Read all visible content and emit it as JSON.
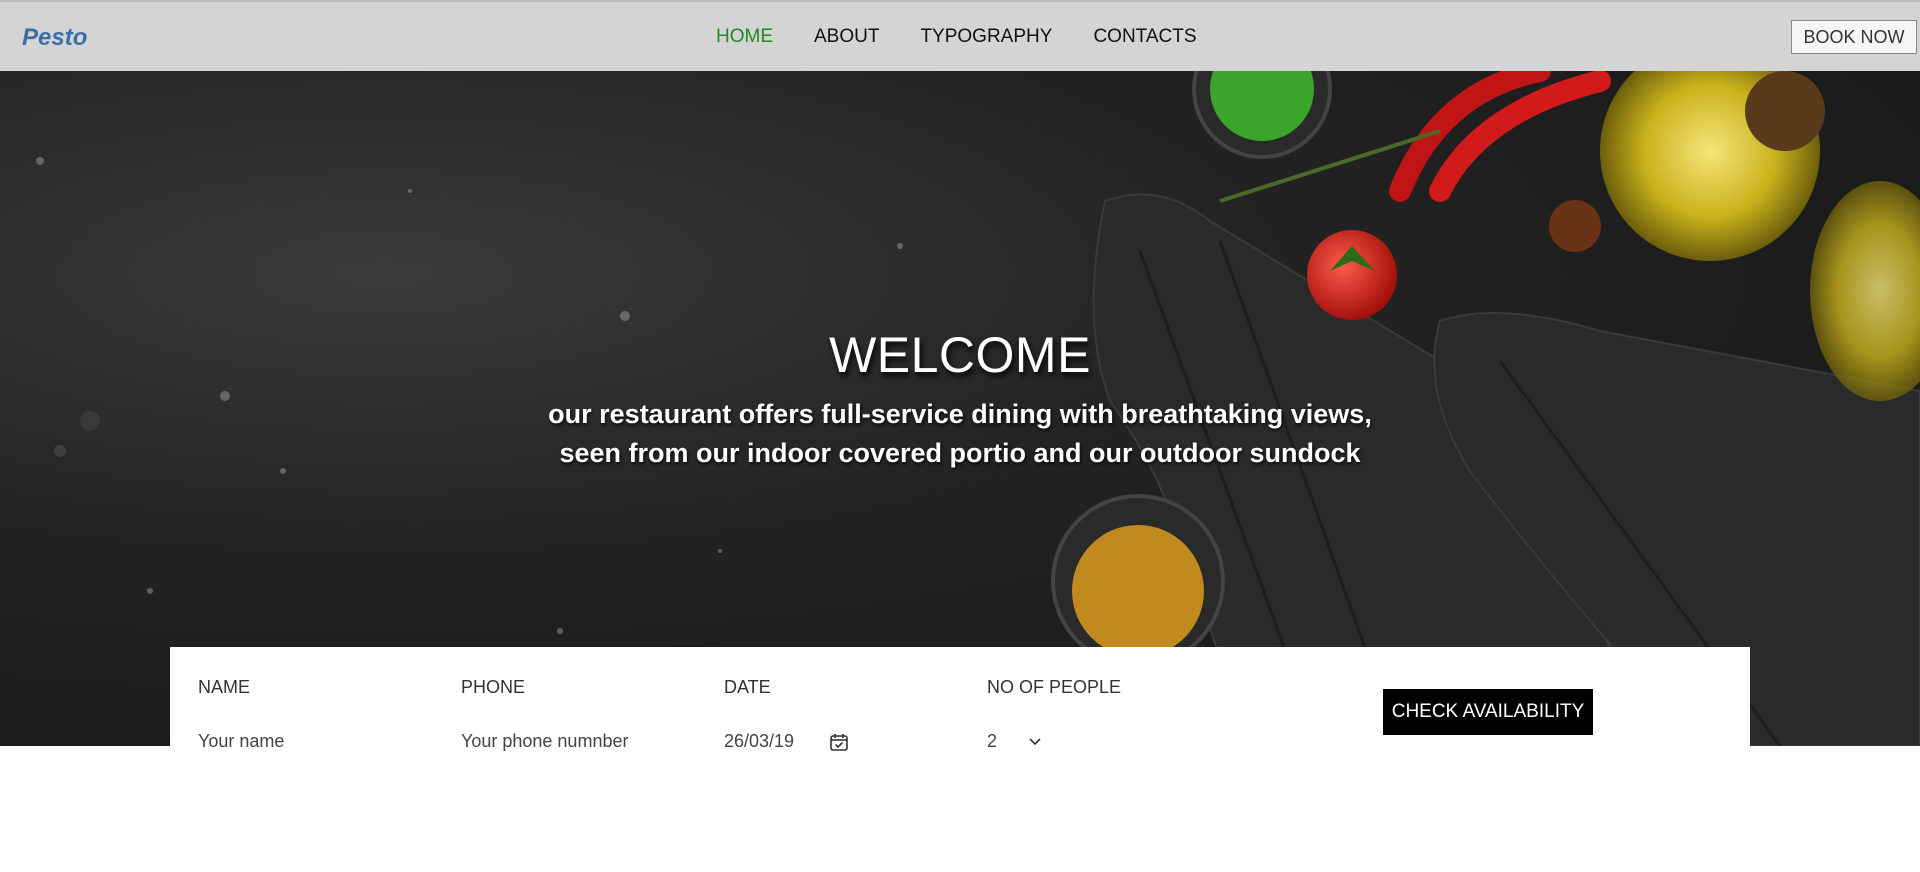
{
  "brand": {
    "name": "Pesto",
    "color": "#3b6ea5"
  },
  "nav": {
    "items": [
      {
        "label": "HOME",
        "active": true
      },
      {
        "label": "ABOUT",
        "active": false
      },
      {
        "label": "TYPOGRAPHY",
        "active": false
      },
      {
        "label": "CONTACTS",
        "active": false
      }
    ],
    "active_color": "#1f8a1f",
    "book_now_label": "BOOK NOW"
  },
  "hero": {
    "title": "WELCOME",
    "tagline_line1": "our restaurant offers full-service dining with breathtaking views,",
    "tagline_line2": "seen from our indoor covered portio and our outdoor sundock"
  },
  "booking": {
    "name": {
      "label": "NAME",
      "placeholder": "Your name"
    },
    "phone": {
      "label": "PHONE",
      "placeholder": "Your phone numnber"
    },
    "date": {
      "label": "DATE",
      "value": "26/03/19",
      "icon": "calendar-check-icon"
    },
    "people": {
      "label": "NO OF PEOPLE",
      "value": "2",
      "icon": "chevron-down-icon"
    },
    "submit_label": "CHECK AVAILABILITY"
  }
}
